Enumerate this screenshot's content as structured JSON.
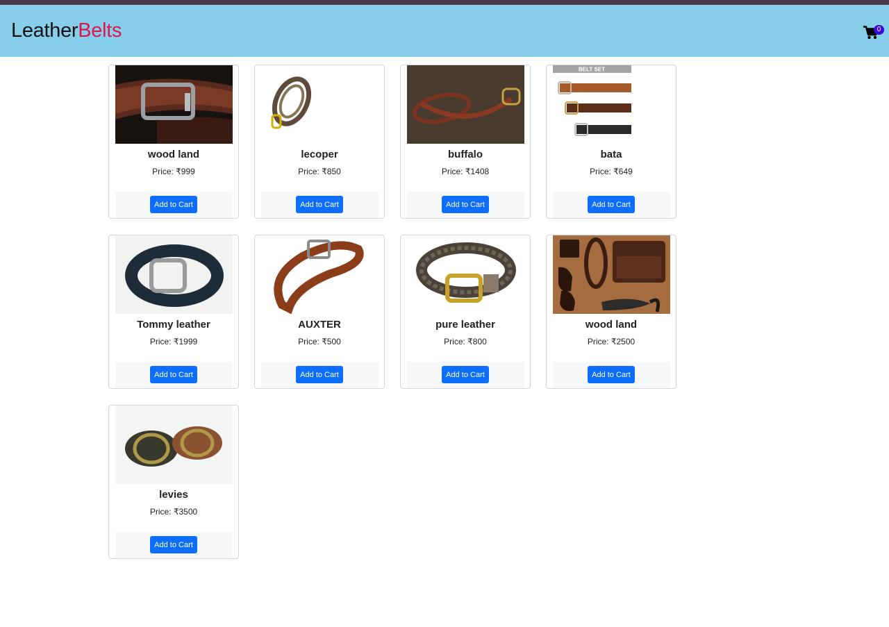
{
  "brand": {
    "part1": "Leather",
    "part2": "Belts"
  },
  "cart": {
    "count": "0",
    "icon": "cart-icon"
  },
  "colors": {
    "navbar": "#87ceeb",
    "brand_accent": "#d9184b",
    "button": "#0d6efd",
    "badge": "#3b0ad6"
  },
  "products": [
    {
      "name": "wood land",
      "price": "Price: ₹999",
      "button": "Add to Cart"
    },
    {
      "name": "lecoper",
      "price": "Price: ₹850",
      "button": "Add to Cart"
    },
    {
      "name": "buffalo",
      "price": "Price: ₹1408",
      "button": "Add to Cart"
    },
    {
      "name": "bata",
      "price": "Price: ₹649",
      "button": "Add to Cart",
      "image_label": "BELT SET"
    },
    {
      "name": "Tommy leather",
      "price": "Price: ₹1999",
      "button": "Add to Cart"
    },
    {
      "name": "AUXTER",
      "price": "Price: ₹500",
      "button": "Add to Cart"
    },
    {
      "name": "pure leather",
      "price": "Price: ₹800",
      "button": "Add to Cart"
    },
    {
      "name": "wood land",
      "price": "Price: ₹2500",
      "button": "Add to Cart"
    },
    {
      "name": "levies",
      "price": "Price: ₹3500",
      "button": "Add to Cart"
    }
  ]
}
